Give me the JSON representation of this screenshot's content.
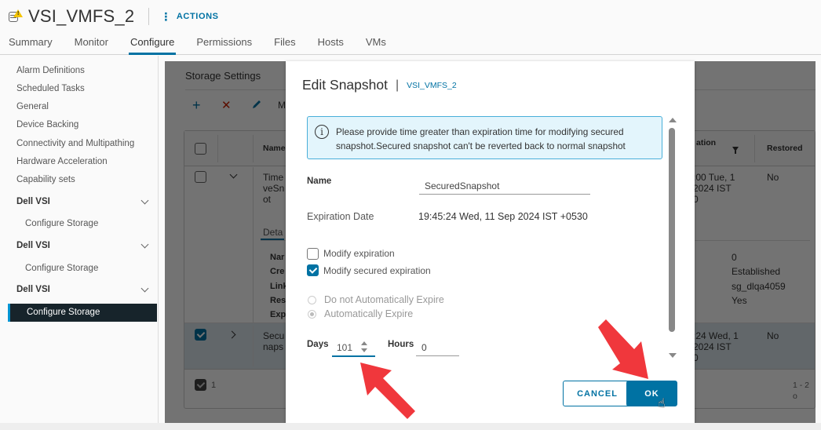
{
  "header": {
    "title": "VSI_VMFS_2",
    "object_icon": "datastore-warning-icon",
    "actions_label": "ACTIONS",
    "tabs": [
      {
        "label": "Summary",
        "active": false
      },
      {
        "label": "Monitor",
        "active": false
      },
      {
        "label": "Configure",
        "active": true
      },
      {
        "label": "Permissions",
        "active": false
      },
      {
        "label": "Files",
        "active": false
      },
      {
        "label": "Hosts",
        "active": false
      },
      {
        "label": "VMs",
        "active": false
      }
    ]
  },
  "sidebar": {
    "items": [
      "Alarm Definitions",
      "Scheduled Tasks",
      "General",
      "Device Backing",
      "Connectivity and Multipathing",
      "Hardware Acceleration",
      "Capability sets"
    ],
    "groups": [
      {
        "label": "Dell VSI",
        "sub": "Configure Storage",
        "selected": false
      },
      {
        "label": "Dell VSI",
        "sub": "Configure Storage",
        "selected": false
      },
      {
        "label": "Dell VSI",
        "sub": "Configure Storage",
        "selected": true
      }
    ]
  },
  "background_panel": {
    "title": "Storage Settings",
    "toolbar": {
      "add": "+",
      "delete": "✕",
      "more_partial": "M"
    },
    "columns": {
      "name_partial": "Name",
      "expiration_partial": "ation",
      "restored": "Restored"
    },
    "rows": [
      {
        "name_partial": [
          "Time",
          "veSn",
          "ot"
        ],
        "expiration_partial": [
          ":00 Tue, 1",
          "2024 IST",
          "0"
        ],
        "restored": "No",
        "selected": false,
        "expanded": true
      },
      {
        "name_partial": [
          "Secu",
          "naps"
        ],
        "expiration_partial": [
          ":24 Wed, 1",
          "2024 IST",
          "0"
        ],
        "restored": "No",
        "selected": true,
        "expanded": false
      }
    ],
    "details": {
      "tab_partial": "Deta",
      "label_partials": [
        "Nar",
        "Cre",
        "Link",
        "Res",
        "Exp"
      ],
      "values": [
        "0",
        "Established",
        "sg_dlqa4059",
        "Yes"
      ]
    },
    "footer": {
      "selected_count": "1",
      "pagination_partial": "1 - 2 o"
    }
  },
  "modal": {
    "title": "Edit Snapshot",
    "object": "VSI_VMFS_2",
    "alert": "Please provide time greater than expiration time for modifying secured snapshot.Secured snapshot can't be reverted back to normal snapshot",
    "name_label": "Name",
    "name_value": "SecuredSnapshot",
    "expiration_label": "Expiration Date",
    "expiration_value": "19:45:24 Wed, 11 Sep 2024 IST +0530",
    "checkboxes": [
      {
        "label": "Modify expiration",
        "checked": false
      },
      {
        "label": "Modify secured expiration",
        "checked": true
      }
    ],
    "radios": [
      {
        "label": "Do not Automatically Expire",
        "selected": false,
        "disabled": true
      },
      {
        "label": "Automatically Expire",
        "selected": true,
        "disabled": true
      }
    ],
    "days_label": "Days",
    "days_value": "101",
    "hours_label": "Hours",
    "hours_value": "0",
    "cancel_label": "CANCEL",
    "ok_label": "OK"
  },
  "annotations": {
    "arrow_color": "#f0373c"
  },
  "colors": {
    "accent": "#0072a3",
    "sidebar_selected_bg": "#17242b",
    "alert_bg": "#e3f5fc",
    "alert_border": "#49afd9"
  }
}
